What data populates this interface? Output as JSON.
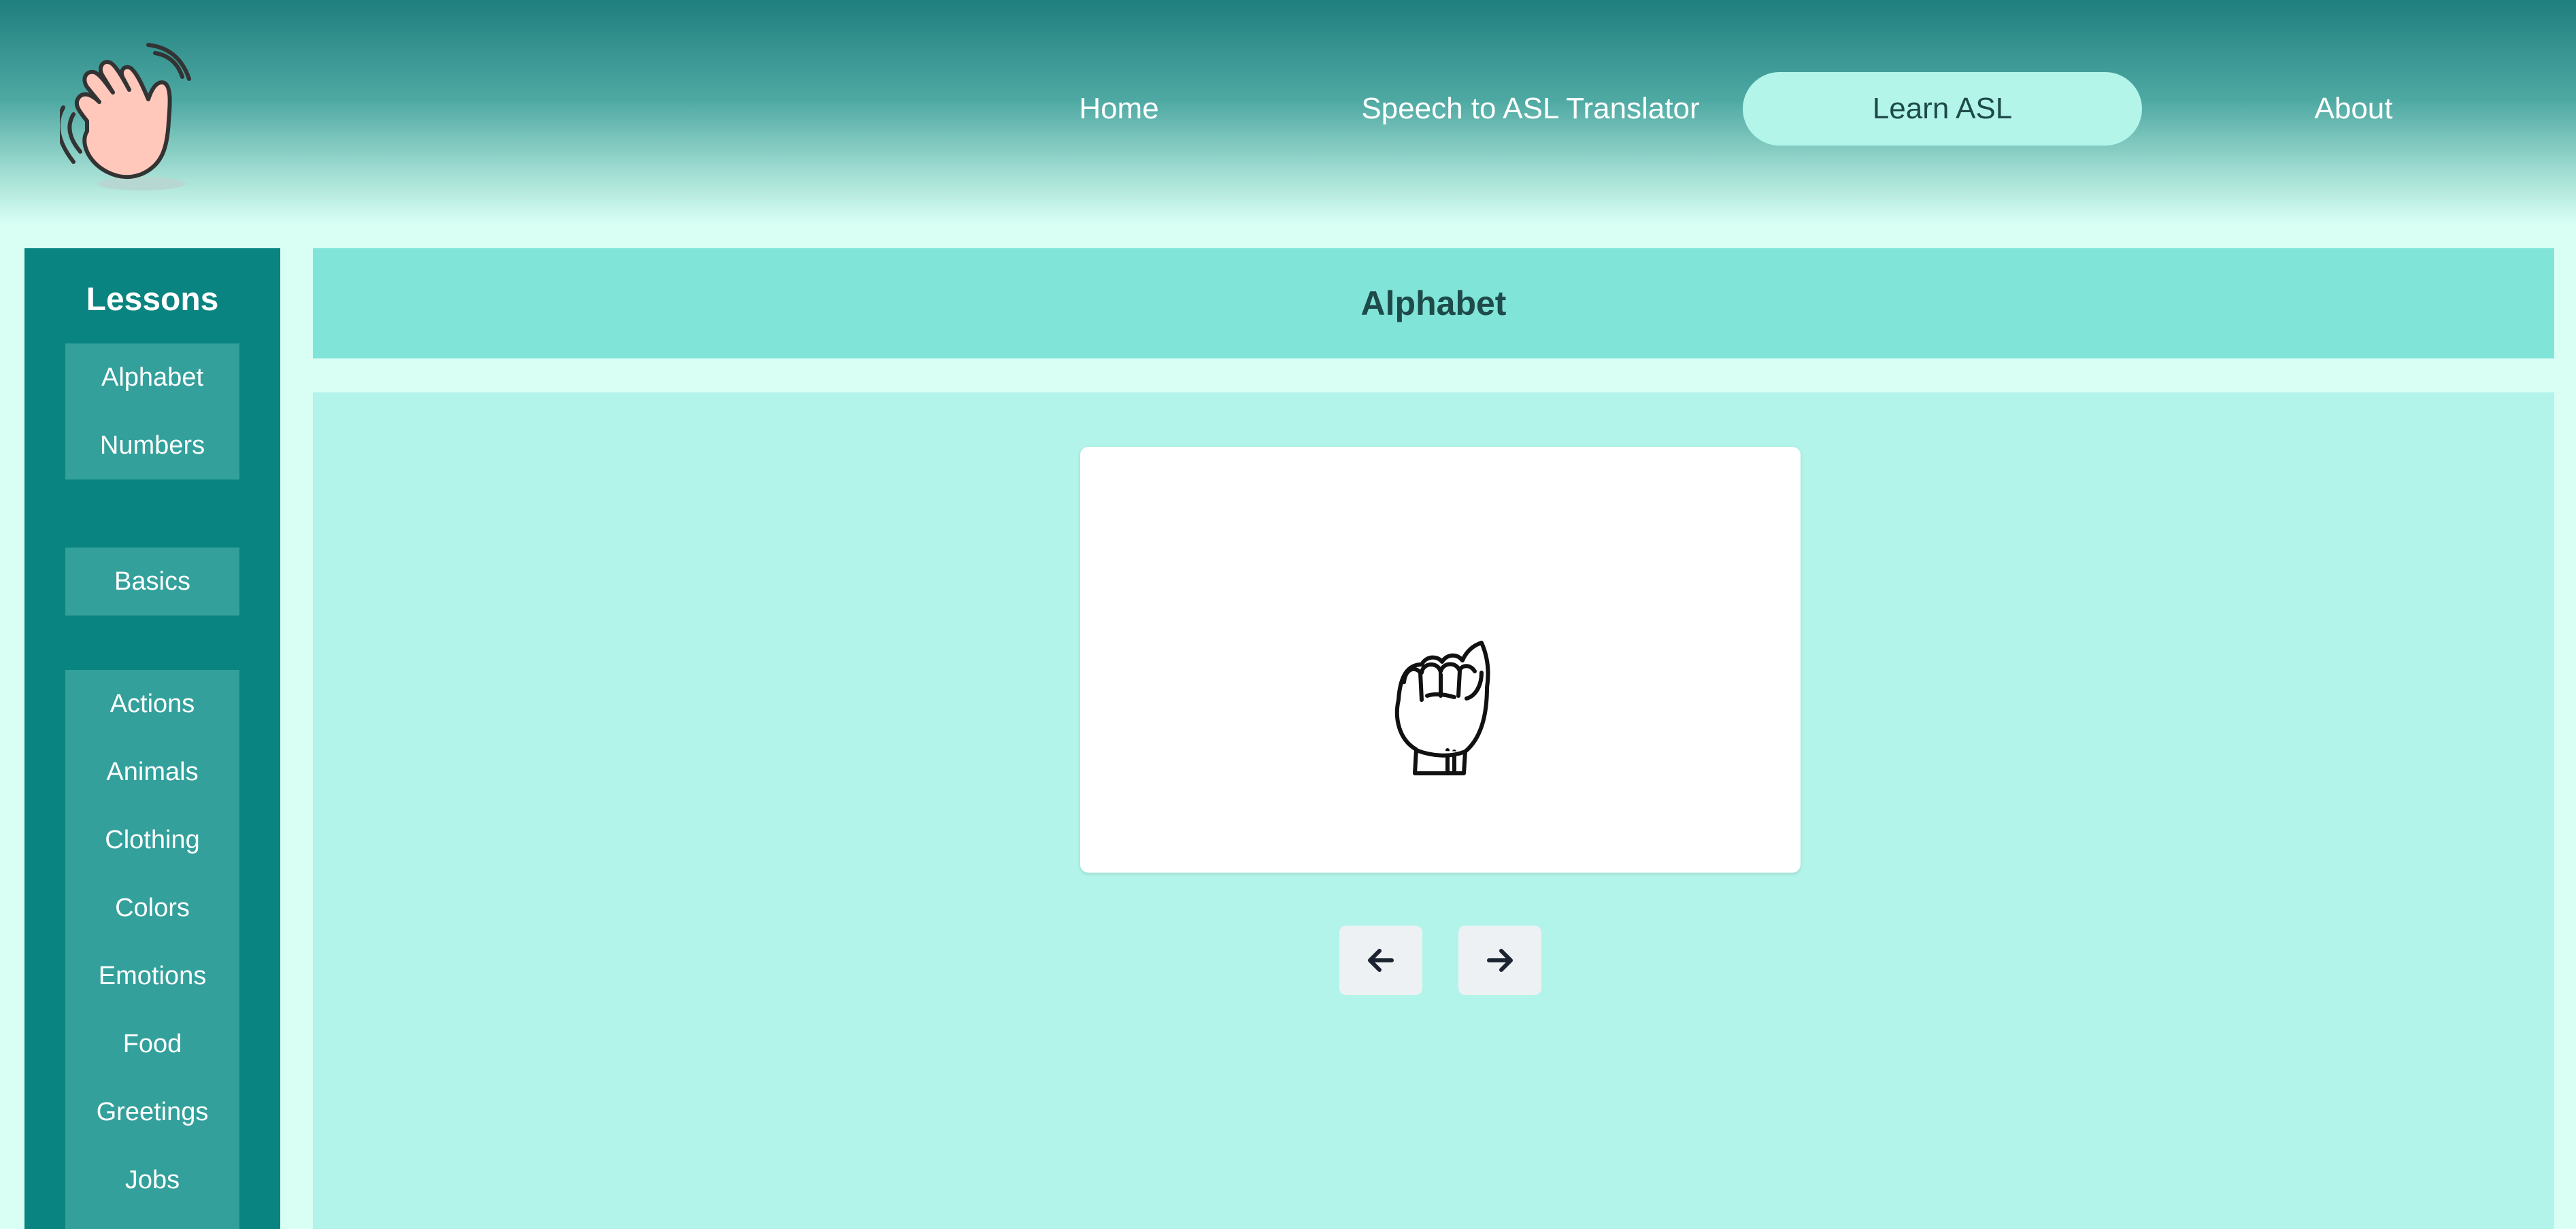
{
  "nav": {
    "home": "Home",
    "speech": "Speech to ASL Translator",
    "learn": "Learn ASL",
    "about": "About",
    "active": "Learn ASL"
  },
  "sidebar": {
    "title": "Lessons",
    "groups": [
      [
        "Alphabet",
        "Numbers"
      ],
      [
        "Basics"
      ],
      [
        "Actions",
        "Animals",
        "Clothing",
        "Colors",
        "Emotions",
        "Food",
        "Greetings",
        "Jobs"
      ]
    ]
  },
  "lesson": {
    "title": "Alphabet",
    "current_sign_icon": "asl-letter-a-hand-icon"
  },
  "controls": {
    "prev_icon": "arrow-left-icon",
    "next_icon": "arrow-right-icon"
  },
  "colors": {
    "sidebar": "#098480",
    "sidebar_item": "#33a09b",
    "active_nav": "#b3f5e9",
    "main_header": "#80e4d8",
    "main_body": "#b2f4e9"
  },
  "logo_icon": "waving-hand-icon"
}
